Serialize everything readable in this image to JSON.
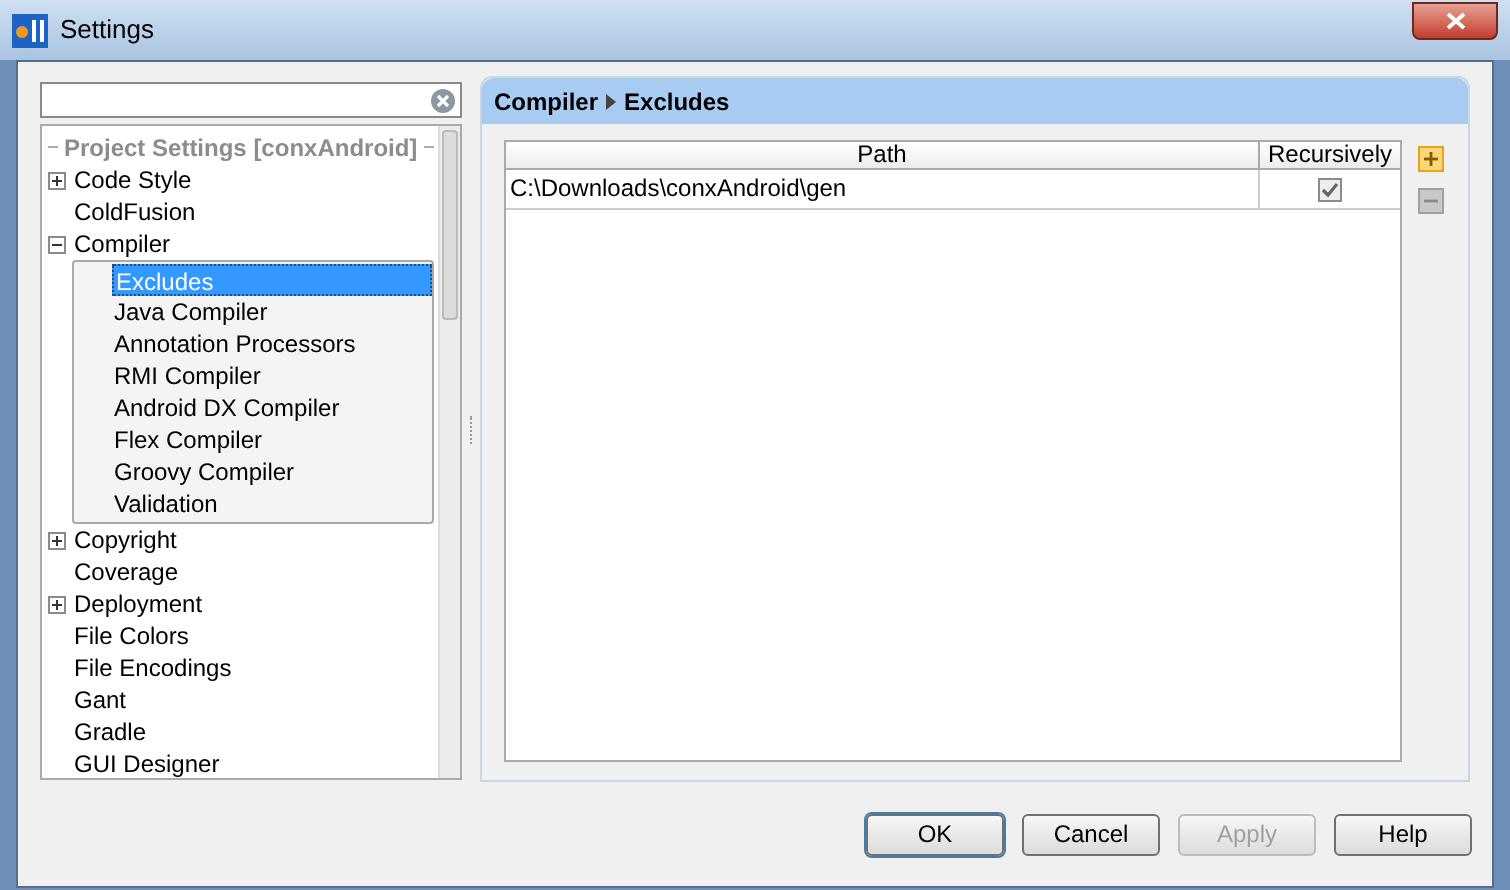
{
  "window": {
    "title": "Settings"
  },
  "tree": {
    "heading": "Project Settings [conxAndroid]",
    "items": [
      {
        "label": "Code Style",
        "kind": "group",
        "expanded": false,
        "selected": false
      },
      {
        "label": "ColdFusion",
        "kind": "leaf",
        "selected": false
      },
      {
        "label": "Compiler",
        "kind": "group",
        "expanded": true,
        "selected": false,
        "children": [
          {
            "label": "Excludes",
            "selected": true
          },
          {
            "label": "Java Compiler",
            "selected": false
          },
          {
            "label": "Annotation Processors",
            "selected": false
          },
          {
            "label": "RMI Compiler",
            "selected": false
          },
          {
            "label": "Android DX Compiler",
            "selected": false
          },
          {
            "label": "Flex Compiler",
            "selected": false
          },
          {
            "label": "Groovy Compiler",
            "selected": false
          },
          {
            "label": "Validation",
            "selected": false
          }
        ]
      },
      {
        "label": "Copyright",
        "kind": "group",
        "expanded": false,
        "selected": false
      },
      {
        "label": "Coverage",
        "kind": "leaf",
        "selected": false
      },
      {
        "label": "Deployment",
        "kind": "group",
        "expanded": false,
        "selected": false
      },
      {
        "label": "File Colors",
        "kind": "leaf",
        "selected": false
      },
      {
        "label": "File Encodings",
        "kind": "leaf",
        "selected": false
      },
      {
        "label": "Gant",
        "kind": "leaf",
        "selected": false
      },
      {
        "label": "Gradle",
        "kind": "leaf",
        "selected": false
      },
      {
        "label": "GUI Designer",
        "kind": "leaf",
        "selected": false
      }
    ]
  },
  "breadcrumb": [
    "Compiler",
    "Excludes"
  ],
  "table": {
    "columns": [
      "Path",
      "Recursively"
    ],
    "rows": [
      {
        "path": "C:\\Downloads\\conxAndroid\\gen",
        "recursively": true
      }
    ]
  },
  "toolbar": [
    {
      "kind": "add",
      "disabled": false
    },
    {
      "kind": "remove",
      "disabled": true
    }
  ],
  "buttons": [
    {
      "label": "OK",
      "default": true,
      "disabled": false
    },
    {
      "label": "Cancel",
      "default": false,
      "disabled": false
    },
    {
      "label": "Apply",
      "default": false,
      "disabled": true
    },
    {
      "label": "Help",
      "default": false,
      "disabled": false
    }
  ]
}
